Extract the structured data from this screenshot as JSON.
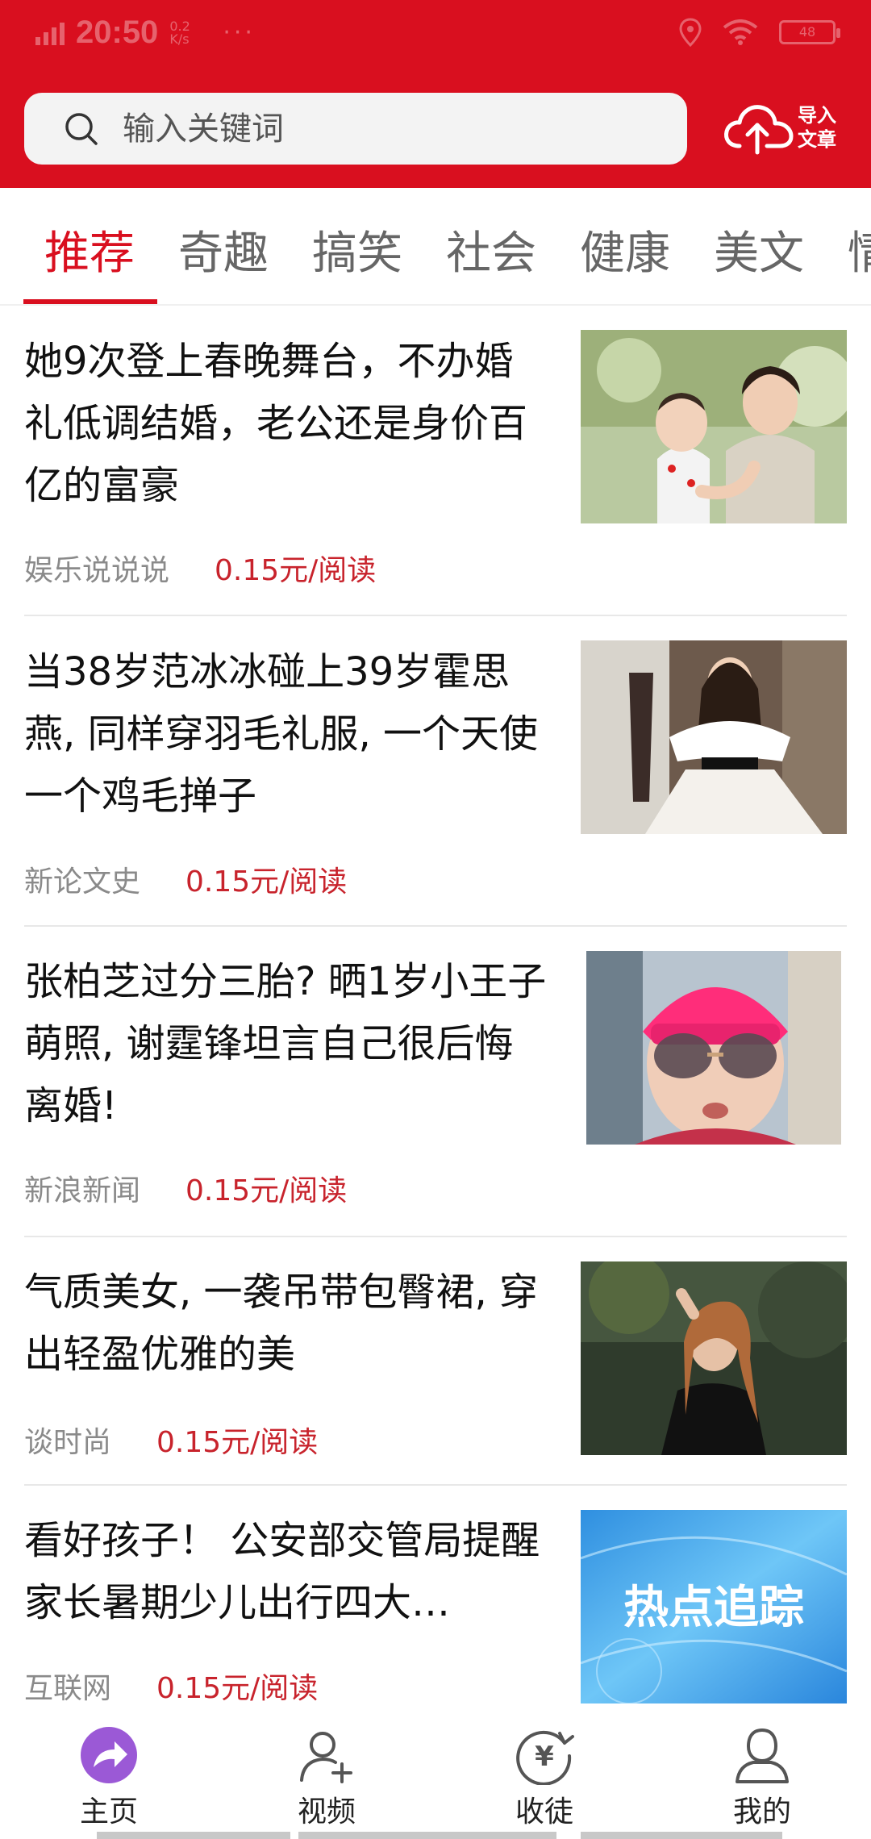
{
  "status_bar": {
    "time": "20:50",
    "speed": "0.2 K/s",
    "dots": "···",
    "battery": "48"
  },
  "search": {
    "placeholder": "输入关键词"
  },
  "import_button": {
    "label": "导入文章",
    "icon": "cloud-upload-icon"
  },
  "tabs": [
    {
      "label": "推荐",
      "active": true
    },
    {
      "label": "奇趣"
    },
    {
      "label": "搞笑"
    },
    {
      "label": "社会"
    },
    {
      "label": "健康"
    },
    {
      "label": "美文"
    },
    {
      "label": "情"
    }
  ],
  "feed": [
    {
      "title": "她9次登上春晚舞台，不办婚礼低调结婚，老公还是身价百亿的富豪",
      "source": "娱乐说说说",
      "price": "0.15元/阅读",
      "image": "woman-holding-child"
    },
    {
      "title": "当38岁范冰冰碰上39岁霍思燕, 同样穿羽毛礼服, 一个天使一个鸡毛掸子",
      "source": "新论文史",
      "price": "0.15元/阅读",
      "image": "woman-white-feather-dress"
    },
    {
      "title": "张柏芝过分三胎? 晒1岁小王子萌照, 谢霆锋坦言自己很后悔离婚!",
      "source": "新浪新闻",
      "price": "0.15元/阅读",
      "image": "woman-pink-beanie-sunglasses"
    },
    {
      "title": "气质美女, 一袭吊带包臀裙, 穿出轻盈优雅的美",
      "source": "谈时尚",
      "price": "0.15元/阅读",
      "image": "woman-street-fashion"
    },
    {
      "title": "看好孩子！ 公安部交管局提醒家长暑期少儿出行四大…",
      "source": "互联网",
      "price": "0.15元/阅读",
      "image": "hotspot-banner",
      "image_text": "热点追踪"
    }
  ],
  "bottom_nav": [
    {
      "label": "主页",
      "icon": "home-share-icon",
      "active": true
    },
    {
      "label": "视频",
      "icon": "user-add-icon"
    },
    {
      "label": "收徒",
      "icon": "yuan-icon"
    },
    {
      "label": "我的",
      "icon": "person-icon"
    }
  ],
  "colors": {
    "brand_red": "#d90f1f",
    "price_red": "#c8232c",
    "active_nav": "#9b59d6"
  }
}
